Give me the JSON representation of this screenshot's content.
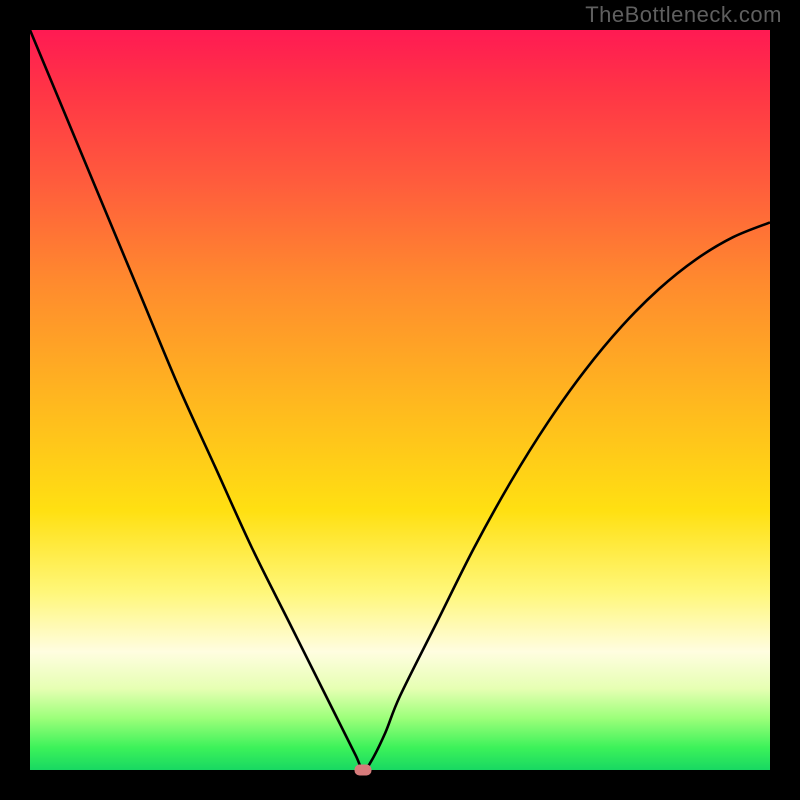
{
  "watermark": "TheBottleneck.com",
  "chart_data": {
    "type": "line",
    "title": "",
    "xlabel": "",
    "ylabel": "",
    "xlim": [
      0,
      100
    ],
    "ylim": [
      0,
      100
    ],
    "grid": false,
    "series": [
      {
        "name": "bottleneck-curve",
        "x": [
          0,
          5,
          10,
          15,
          20,
          25,
          30,
          35,
          40,
          42,
          44,
          45,
          46,
          48,
          50,
          55,
          60,
          65,
          70,
          75,
          80,
          85,
          90,
          95,
          100
        ],
        "values": [
          100,
          88,
          76,
          64,
          52,
          41,
          30,
          20,
          10,
          6,
          2,
          0,
          1,
          5,
          10,
          20,
          30,
          39,
          47,
          54,
          60,
          65,
          69,
          72,
          74
        ]
      }
    ],
    "marker": {
      "x": 45,
      "y": 0
    },
    "background_gradient": {
      "top": "#ff1a53",
      "mid": "#ffe012",
      "bottom": "#18d862"
    }
  }
}
